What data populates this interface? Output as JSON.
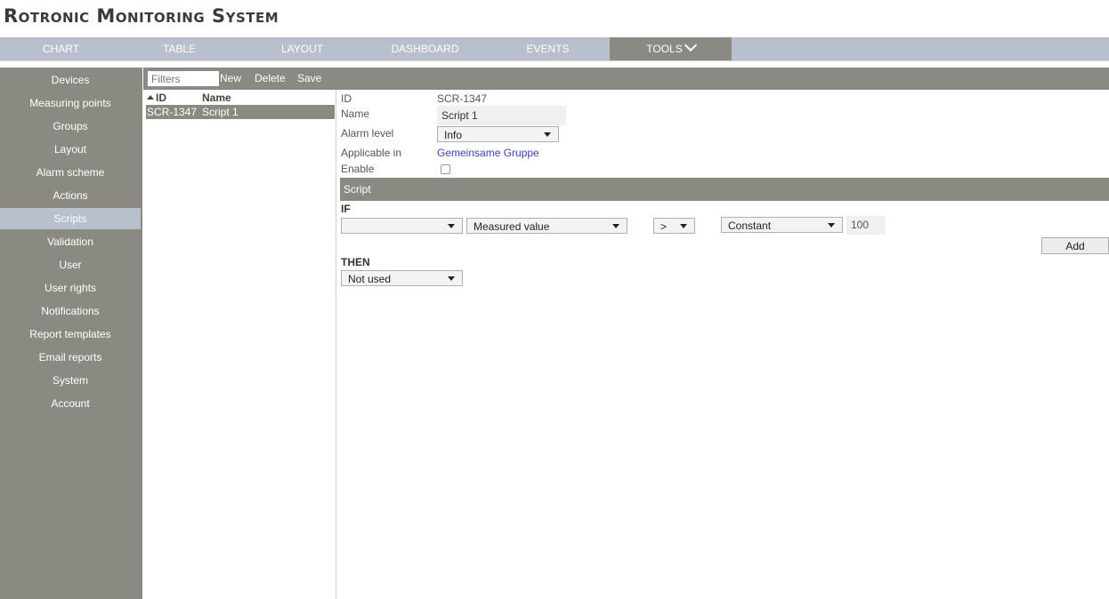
{
  "app": {
    "title": "Rotronic Monitoring System"
  },
  "topnav": {
    "tabs": [
      {
        "label": "CHART"
      },
      {
        "label": "TABLE"
      },
      {
        "label": "LAYOUT"
      },
      {
        "label": "DASHBOARD"
      },
      {
        "label": "EVENTS"
      },
      {
        "label": "TOOLS",
        "active": true
      }
    ]
  },
  "sidebar": {
    "active_item": "Scripts",
    "items": [
      {
        "label": "Devices"
      },
      {
        "label": "Measuring points"
      },
      {
        "label": "Groups"
      },
      {
        "label": "Layout"
      },
      {
        "label": "Alarm scheme"
      },
      {
        "label": "Actions"
      },
      {
        "label": "Scripts"
      },
      {
        "label": "Validation"
      },
      {
        "label": "User"
      },
      {
        "label": "User rights"
      },
      {
        "label": "Notifications"
      },
      {
        "label": "Report templates"
      },
      {
        "label": "Email reports"
      },
      {
        "label": "System"
      },
      {
        "label": "Account"
      }
    ]
  },
  "toolbar": {
    "filter_placeholder": "Filters",
    "new_label": "New",
    "delete_label": "Delete",
    "save_label": "Save"
  },
  "list": {
    "columns": {
      "id": "ID",
      "name": "Name"
    },
    "rows": [
      {
        "id": "SCR-1347",
        "name": "Script 1"
      }
    ]
  },
  "detail": {
    "id_label": "ID",
    "id_value": "SCR-1347",
    "name_label": "Name",
    "name_value": "Script 1",
    "alarm_level_label": "Alarm level",
    "alarm_level_value": "Info",
    "applicable_label": "Applicable in",
    "applicable_value": "Gemeinsame Gruppe",
    "enable_label": "Enable",
    "enable_checked": false
  },
  "script": {
    "section_title": "Script",
    "if_label": "IF",
    "if_source_value": "",
    "if_measure_value": "Measured value",
    "if_operator_value": ">",
    "if_compare_type_value": "Constant",
    "if_constant_value": "100",
    "add_label": "Add",
    "then_label": "THEN",
    "then_value": "Not used"
  },
  "colors": {
    "nav_bg": "#b7c0cc",
    "panel_gray": "#8a8a83",
    "link": "#3a44b0"
  }
}
